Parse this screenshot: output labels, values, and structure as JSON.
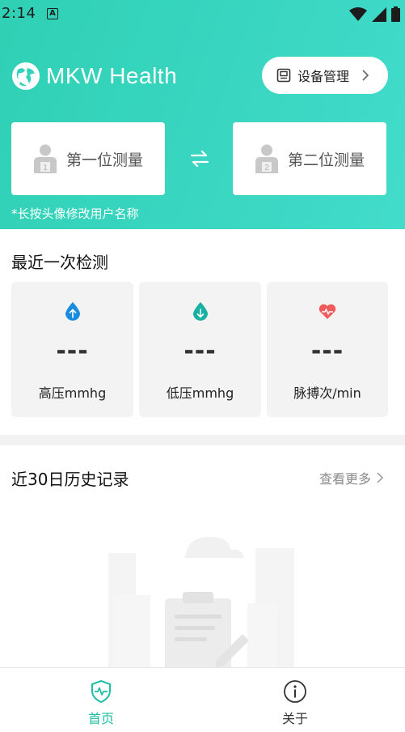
{
  "status_bar": {
    "time": "2:14",
    "notification_icon": "A"
  },
  "header": {
    "app_name": "MKW Health",
    "device_button_label": "设备管理",
    "hint": "*长按头像修改用户名称"
  },
  "users": [
    {
      "label": "第一位测量",
      "badge": "1"
    },
    {
      "label": "第二位测量",
      "badge": "2"
    }
  ],
  "recent": {
    "title": "最近一次检测",
    "metrics": [
      {
        "value": "---",
        "label": "高压mmhg",
        "icon": "blood-drop-up-icon",
        "color": "#1a8ce0"
      },
      {
        "value": "---",
        "label": "低压mmhg",
        "icon": "blood-drop-down-icon",
        "color": "#16b1a0"
      },
      {
        "value": "---",
        "label": "脉搏次/min",
        "icon": "heart-pulse-icon",
        "color": "#f05a5a"
      }
    ]
  },
  "history": {
    "title": "近30日历史记录",
    "more_label": "查看更多"
  },
  "nav": {
    "items": [
      {
        "label": "首页",
        "icon": "shield-pulse-icon",
        "active": true
      },
      {
        "label": "关于",
        "icon": "info-icon",
        "active": false
      }
    ]
  },
  "colors": {
    "accent": "#2fd0b4",
    "active_nav": "#1dbfa4"
  }
}
